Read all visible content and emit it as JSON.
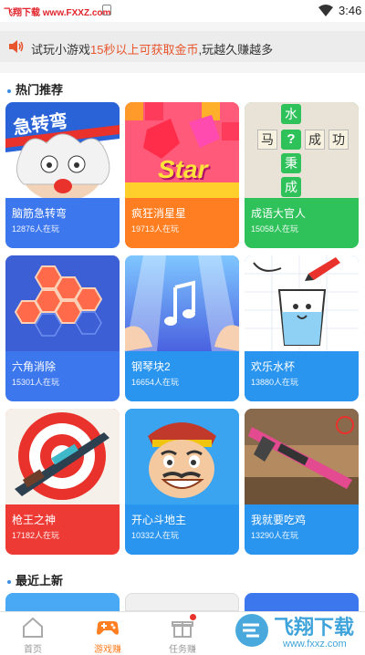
{
  "statusbar": {
    "watermark": "飞翔下载 www.FXXZ.com",
    "time": "3:46"
  },
  "notice": {
    "prefix": "试玩小游戏",
    "highlight": "15秒以上可获取金币",
    "suffix": ",玩越久赚越多"
  },
  "sections": {
    "hot": "热门推荐",
    "recent": "最近上新"
  },
  "games": [
    {
      "name": "脑筋急转弯",
      "players": "12876人在玩",
      "color": "#3d77ee",
      "art_text": "急转弯"
    },
    {
      "name": "疯狂消星星",
      "players": "19713人在玩",
      "color": "#ff7e21",
      "art_text": "Star"
    },
    {
      "name": "成语大官人",
      "players": "15058人在玩",
      "color": "#2fc25b",
      "art_chars": [
        "水",
        "马",
        "?",
        "成",
        "功",
        "秉",
        "成"
      ]
    },
    {
      "name": "六角消除",
      "players": "15301人在玩",
      "color": "#3d77ee"
    },
    {
      "name": "钢琴块2",
      "players": "16654人在玩",
      "color": "#2a95ef"
    },
    {
      "name": "欢乐水杯",
      "players": "13880人在玩",
      "color": "#2a95ef"
    },
    {
      "name": "枪王之神",
      "players": "17182人在玩",
      "color": "#ee3a34"
    },
    {
      "name": "开心斗地主",
      "players": "10332人在玩",
      "color": "#2a95ef"
    },
    {
      "name": "我就要吃鸡",
      "players": "13290人在玩",
      "color": "#2a95ef"
    }
  ],
  "nav": [
    {
      "label": "首页",
      "active": false
    },
    {
      "label": "游戏赚",
      "active": true
    },
    {
      "label": "任务赚",
      "active": false
    },
    {
      "label": "",
      "active": false
    },
    {
      "label": "",
      "active": false
    }
  ],
  "watermark_logo": {
    "text": "飞翔下载",
    "url": "www.fxxz.com"
  }
}
